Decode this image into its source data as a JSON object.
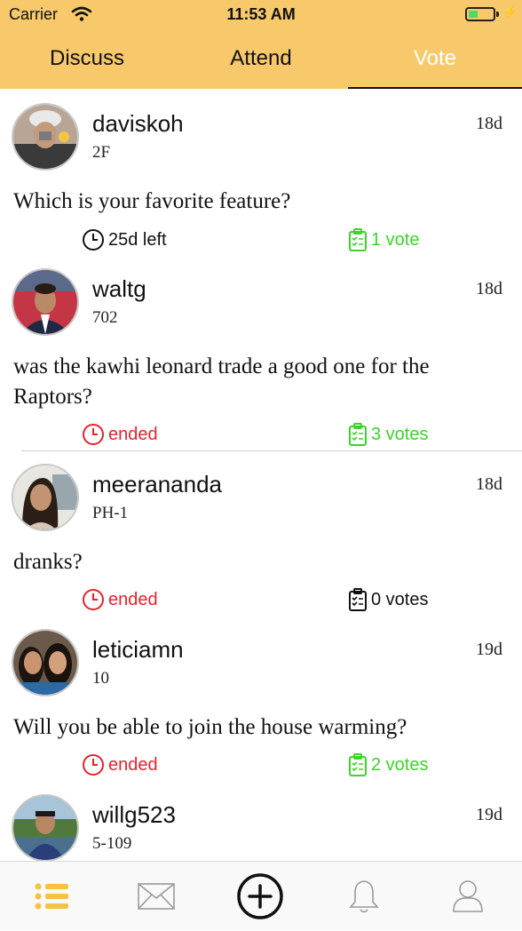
{
  "status": {
    "carrier": "Carrier",
    "time": "11:53 AM",
    "battery_level": 0.4
  },
  "tabs": [
    {
      "label": "Discuss",
      "active": false
    },
    {
      "label": "Attend",
      "active": false
    },
    {
      "label": "Vote",
      "active": true
    }
  ],
  "colors": {
    "header": "#f7c96a",
    "ended": "#e8212b",
    "voted": "#3bd428",
    "active_tab": "#ffffff"
  },
  "posts": [
    {
      "username": "daviskoh",
      "unit": "2F",
      "age": "18d",
      "question": "Which is your favorite feature?",
      "time_text": "25d left",
      "time_status": "active",
      "votes_text": "1 vote",
      "voted": true
    },
    {
      "username": "waltg",
      "unit": "702",
      "age": "18d",
      "question": "was the kawhi leonard trade a good one for the Raptors?",
      "time_text": "ended",
      "time_status": "ended",
      "votes_text": "3 votes",
      "voted": true
    },
    {
      "username": "meerananda",
      "unit": "PH-1",
      "age": "18d",
      "question": "dranks?",
      "time_text": "ended",
      "time_status": "ended",
      "votes_text": "0 votes",
      "voted": false
    },
    {
      "username": "leticiamn",
      "unit": "10",
      "age": "19d",
      "question": "Will you be able to join the house warming?",
      "time_text": "ended",
      "time_status": "ended",
      "votes_text": "2 votes",
      "voted": true
    },
    {
      "username": "willg523",
      "unit": "5-109",
      "age": "19d",
      "question": "",
      "time_text": "",
      "time_status": "",
      "votes_text": "",
      "voted": false
    }
  ],
  "bottom_nav": [
    {
      "icon": "list-icon",
      "active": true
    },
    {
      "icon": "mail-icon",
      "active": false
    },
    {
      "icon": "add-circle-icon",
      "active": false
    },
    {
      "icon": "bell-icon",
      "active": false
    },
    {
      "icon": "profile-icon",
      "active": false
    }
  ]
}
